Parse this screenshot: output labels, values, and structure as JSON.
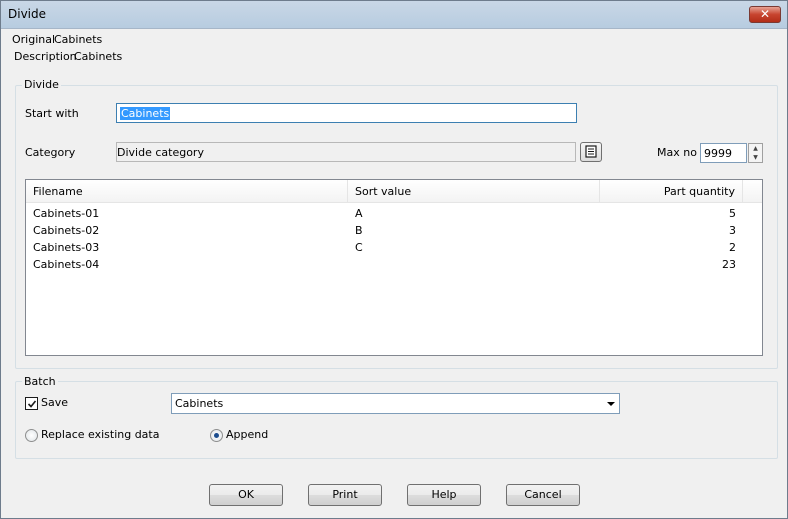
{
  "window": {
    "title": "Divide",
    "close_glyph": "✕"
  },
  "info": {
    "original_label": "Original",
    "original_value": "Cabinets",
    "description_label": "Description",
    "description_value": "Cabinets"
  },
  "divide": {
    "group_label": "Divide",
    "start_with_label": "Start with",
    "start_with_value": "Cabinets",
    "category_label": "Category",
    "category_value": "Divide category",
    "category_button_icon": "list-icon",
    "max_no_label": "Max no",
    "max_no_value": "9999"
  },
  "table": {
    "columns": [
      "Filename",
      "Sort value",
      "Part quantity"
    ],
    "rows": [
      {
        "filename": "Cabinets-01",
        "sort": "A",
        "qty": "5"
      },
      {
        "filename": "Cabinets-02",
        "sort": "B",
        "qty": "3"
      },
      {
        "filename": "Cabinets-03",
        "sort": "C",
        "qty": "2"
      },
      {
        "filename": "Cabinets-04",
        "sort": "",
        "qty": "23"
      }
    ]
  },
  "batch": {
    "group_label": "Batch",
    "save_label": "Save",
    "save_checked": true,
    "save_combo_value": "Cabinets",
    "replace_label": "Replace existing data",
    "append_label": "Append",
    "selected_mode": "append"
  },
  "buttons": {
    "ok": "OK",
    "print": "Print",
    "help": "Help",
    "cancel": "Cancel"
  },
  "colors": {
    "selection": "#3399ff",
    "title_bar": "#c9d7e6",
    "close_button": "#c7442f"
  }
}
